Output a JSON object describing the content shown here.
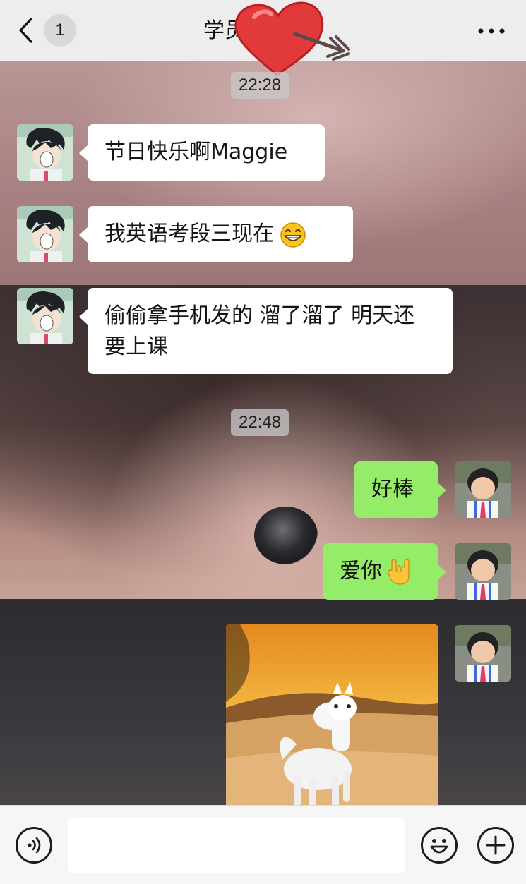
{
  "nav": {
    "back_label": "<",
    "unread_count": "1",
    "title": "学员"
  },
  "timestamps": [
    "22:28",
    "22:48"
  ],
  "messages": [
    {
      "side": "left",
      "text": "节日快乐啊Maggie"
    },
    {
      "side": "left",
      "text": "我英语考段三现在"
    },
    {
      "side": "left",
      "text": "偷偷拿手机发的 溜了溜了 明天还要上课"
    },
    {
      "side": "right",
      "text": "好棒"
    },
    {
      "side": "right",
      "text": "爱你"
    }
  ],
  "icons": {
    "back": "chevron-left-icon",
    "more": "ellipsis-icon",
    "sticker": "heart-arrow-sticker",
    "emoji_grin": "grinning-face-emoji",
    "emoji_hand": "love-you-gesture-emoji",
    "voice": "voice-icon",
    "emoji_panel": "smiley-icon",
    "plus": "plus-icon"
  },
  "colors": {
    "self_bubble": "#95ec69",
    "other_bubble": "#ffffff",
    "nav_bg": "#ededed",
    "sticker_heart": "#e23a3a"
  }
}
